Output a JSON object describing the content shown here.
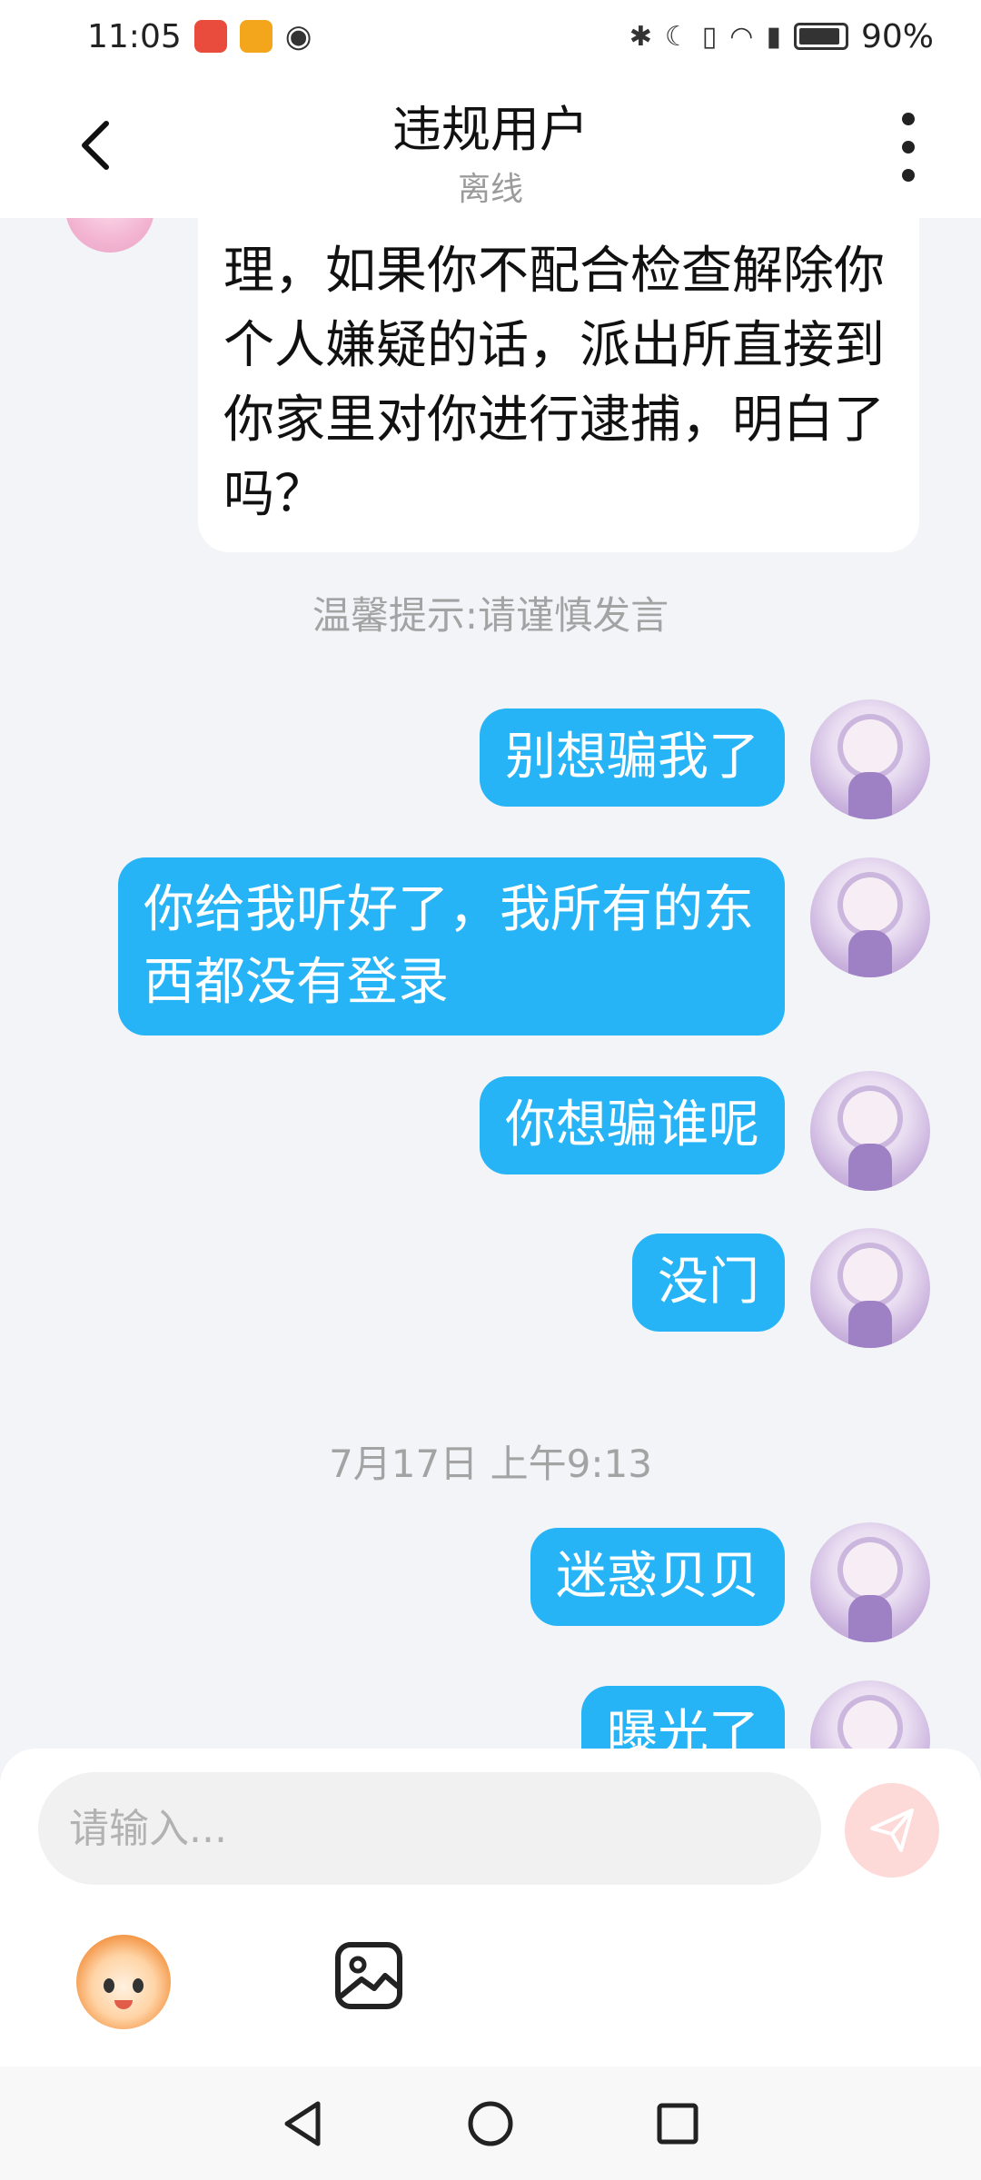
{
  "status_bar": {
    "time": "11:05",
    "battery": "90%",
    "icons": [
      "huawei-app-icon",
      "wallet-app-icon",
      "eye-icon",
      "bluetooth-icon",
      "moon-icon",
      "vibrate-icon",
      "wifi-icon",
      "sim-icon",
      "battery-icon"
    ]
  },
  "header": {
    "title": "违规用户",
    "status": "离线"
  },
  "messages": {
    "incoming_text": "理，如果你不配合检查解除你个人嫌疑的话，派出所直接到你家里对你进行逮捕，明白了吗？",
    "tip": "温馨提示:请谨慎发言",
    "timestamp": "7月17日 上午9:13",
    "outgoing": [
      "别想骗我了",
      "你给我听好了，我所有的东西都没有登录",
      "你想骗谁呢",
      "没门",
      "迷惑贝贝",
      "曝光了"
    ]
  },
  "input": {
    "placeholder": "请输入..."
  },
  "colors": {
    "outgoing_bubble": "#26b4f6",
    "send_button": "#fdd9d7",
    "background": "#f2f4f7"
  }
}
